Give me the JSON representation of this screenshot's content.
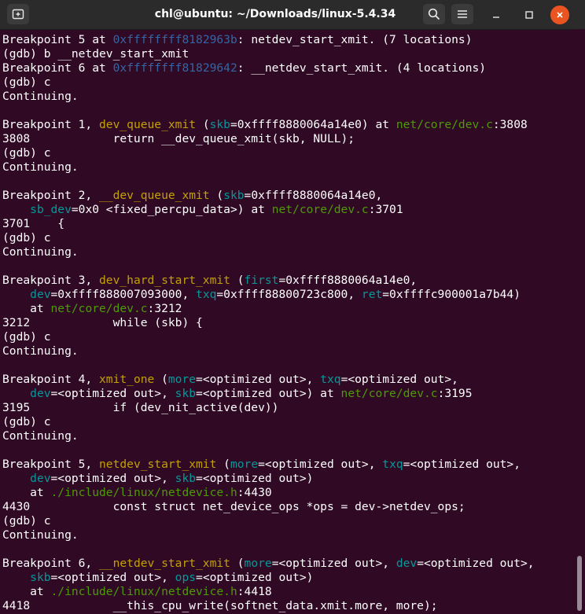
{
  "window": {
    "title": "chl@ubuntu: ~/Downloads/linux-5.4.34"
  },
  "icons": {
    "new_tab": "new-tab-icon",
    "search": "search-icon",
    "menu": "hamburger-menu-icon",
    "minimize": "minimize-icon",
    "maximize": "maximize-icon",
    "close": "close-icon"
  },
  "colors": {
    "background": "#300a24",
    "text": "#ffffff",
    "function": "#c4a000",
    "address": "#3465a4",
    "argument": "#06989a",
    "file": "#4e9a06",
    "close_button": "#e95420"
  },
  "terminal": {
    "lines": [
      [
        {
          "t": "Breakpoint 5 at "
        },
        {
          "t": "0xffffffff8182963b",
          "c": "addr"
        },
        {
          "t": ": netdev_start_xmit. (7 locations)"
        }
      ],
      [
        {
          "t": "(gdb) b __netdev_start_xmit"
        }
      ],
      [
        {
          "t": "Breakpoint 6 at "
        },
        {
          "t": "0xffffffff81829642",
          "c": "addr"
        },
        {
          "t": ": __netdev_start_xmit. (4 locations)"
        }
      ],
      [
        {
          "t": "(gdb) c"
        }
      ],
      [
        {
          "t": "Continuing."
        }
      ],
      [
        {
          "t": ""
        }
      ],
      [
        {
          "t": "Breakpoint 1, "
        },
        {
          "t": "dev_queue_xmit",
          "c": "func"
        },
        {
          "t": " ("
        },
        {
          "t": "skb",
          "c": "arg"
        },
        {
          "t": "=0xffff8880064a14e0) at "
        },
        {
          "t": "net/core/dev.c",
          "c": "file"
        },
        {
          "t": ":3808"
        }
      ],
      [
        {
          "t": "3808            return __dev_queue_xmit(skb, NULL);"
        }
      ],
      [
        {
          "t": "(gdb) c"
        }
      ],
      [
        {
          "t": "Continuing."
        }
      ],
      [
        {
          "t": ""
        }
      ],
      [
        {
          "t": "Breakpoint 2, "
        },
        {
          "t": "__dev_queue_xmit",
          "c": "func"
        },
        {
          "t": " ("
        },
        {
          "t": "skb",
          "c": "arg"
        },
        {
          "t": "=0xffff8880064a14e0,"
        }
      ],
      [
        {
          "t": "    "
        },
        {
          "t": "sb_dev",
          "c": "arg"
        },
        {
          "t": "=0x0 <fixed_percpu_data>) at "
        },
        {
          "t": "net/core/dev.c",
          "c": "file"
        },
        {
          "t": ":3701"
        }
      ],
      [
        {
          "t": "3701    {"
        }
      ],
      [
        {
          "t": "(gdb) c"
        }
      ],
      [
        {
          "t": "Continuing."
        }
      ],
      [
        {
          "t": ""
        }
      ],
      [
        {
          "t": "Breakpoint 3, "
        },
        {
          "t": "dev_hard_start_xmit",
          "c": "func"
        },
        {
          "t": " ("
        },
        {
          "t": "first",
          "c": "arg"
        },
        {
          "t": "=0xffff8880064a14e0,"
        }
      ],
      [
        {
          "t": "    "
        },
        {
          "t": "dev",
          "c": "arg"
        },
        {
          "t": "=0xffff888007093000, "
        },
        {
          "t": "txq",
          "c": "arg"
        },
        {
          "t": "=0xffff88800723c800, "
        },
        {
          "t": "ret",
          "c": "arg"
        },
        {
          "t": "=0xffffc900001a7b44)"
        }
      ],
      [
        {
          "t": "    at "
        },
        {
          "t": "net/core/dev.c",
          "c": "file"
        },
        {
          "t": ":3212"
        }
      ],
      [
        {
          "t": "3212            while (skb) {"
        }
      ],
      [
        {
          "t": "(gdb) c"
        }
      ],
      [
        {
          "t": "Continuing."
        }
      ],
      [
        {
          "t": ""
        }
      ],
      [
        {
          "t": "Breakpoint 4, "
        },
        {
          "t": "xmit_one",
          "c": "func"
        },
        {
          "t": " ("
        },
        {
          "t": "more",
          "c": "arg"
        },
        {
          "t": "=<optimized out>, "
        },
        {
          "t": "txq",
          "c": "arg"
        },
        {
          "t": "=<optimized out>,"
        }
      ],
      [
        {
          "t": "    "
        },
        {
          "t": "dev",
          "c": "arg"
        },
        {
          "t": "=<optimized out>, "
        },
        {
          "t": "skb",
          "c": "arg"
        },
        {
          "t": "=<optimized out>) at "
        },
        {
          "t": "net/core/dev.c",
          "c": "file"
        },
        {
          "t": ":3195"
        }
      ],
      [
        {
          "t": "3195            if (dev_nit_active(dev))"
        }
      ],
      [
        {
          "t": "(gdb) c"
        }
      ],
      [
        {
          "t": "Continuing."
        }
      ],
      [
        {
          "t": ""
        }
      ],
      [
        {
          "t": "Breakpoint 5, "
        },
        {
          "t": "netdev_start_xmit",
          "c": "func"
        },
        {
          "t": " ("
        },
        {
          "t": "more",
          "c": "arg"
        },
        {
          "t": "=<optimized out>, "
        },
        {
          "t": "txq",
          "c": "arg"
        },
        {
          "t": "=<optimized out>,"
        }
      ],
      [
        {
          "t": "    "
        },
        {
          "t": "dev",
          "c": "arg"
        },
        {
          "t": "=<optimized out>, "
        },
        {
          "t": "skb",
          "c": "arg"
        },
        {
          "t": "=<optimized out>)"
        }
      ],
      [
        {
          "t": "    at "
        },
        {
          "t": "./include/linux/netdevice.h",
          "c": "file"
        },
        {
          "t": ":4430"
        }
      ],
      [
        {
          "t": "4430            const struct net_device_ops *ops = dev->netdev_ops;"
        }
      ],
      [
        {
          "t": "(gdb) c"
        }
      ],
      [
        {
          "t": "Continuing."
        }
      ],
      [
        {
          "t": ""
        }
      ],
      [
        {
          "t": "Breakpoint 6, "
        },
        {
          "t": "__netdev_start_xmit",
          "c": "func"
        },
        {
          "t": " ("
        },
        {
          "t": "more",
          "c": "arg"
        },
        {
          "t": "=<optimized out>, "
        },
        {
          "t": "dev",
          "c": "arg"
        },
        {
          "t": "=<optimized out>,"
        }
      ],
      [
        {
          "t": "    "
        },
        {
          "t": "skb",
          "c": "arg"
        },
        {
          "t": "=<optimized out>, "
        },
        {
          "t": "ops",
          "c": "arg"
        },
        {
          "t": "=<optimized out>)"
        }
      ],
      [
        {
          "t": "    at "
        },
        {
          "t": "./include/linux/netdevice.h",
          "c": "file"
        },
        {
          "t": ":4418"
        }
      ],
      [
        {
          "t": "4418            __this_cpu_write(softnet_data.xmit.more, more);"
        }
      ]
    ]
  }
}
